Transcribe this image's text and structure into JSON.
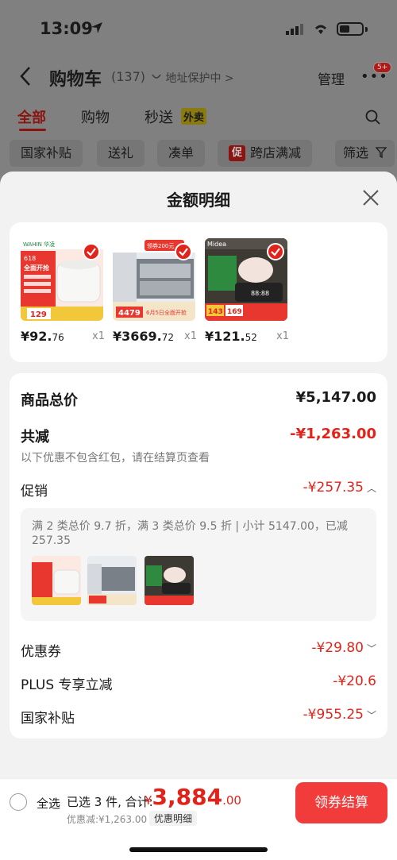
{
  "status": {
    "time": "13:09"
  },
  "nav": {
    "back_label": "<",
    "title": "购物车",
    "count": "(137)",
    "address_protect": "地址保护中 >",
    "manage": "管理",
    "more_badge": "5+"
  },
  "tabs": [
    {
      "label": "全部"
    },
    {
      "label": "购物"
    },
    {
      "label": "秒送"
    }
  ],
  "tab_badge": "外卖",
  "filters": {
    "subsidy": "国家补贴",
    "gift": "送礼",
    "together": "凑单",
    "promo_icon": "促",
    "crossstore": "跨店满减",
    "filter": "筛选"
  },
  "sheet": {
    "title": "金额明细",
    "products": [
      {
        "price_int": "¥92.",
        "price_dec": "76",
        "qty": "x1"
      },
      {
        "price_int": "¥3669.",
        "price_dec": "72",
        "qty": "x1"
      },
      {
        "price_int": "¥121.",
        "price_dec": "52",
        "qty": "x1"
      }
    ],
    "thumb_texts": {
      "p1_brand": "WAHIN 华凌",
      "p1_tag": "618",
      "p1_banner": "全面开抢",
      "p1_price": "129",
      "p2_banner": "领券200元",
      "p2_price": "4479",
      "p2_tag": "6月5日全面开抢",
      "p3_brand": "Midea",
      "p3_price": "143",
      "p3_price2": "169"
    },
    "summary": {
      "total_label": "商品总价",
      "total_value": "¥5,147.00",
      "discount_label": "共减",
      "discount_value": "-¥1,263.00",
      "note": "以下优惠不包含红包，请在结算页查看",
      "promo_label": "促销",
      "promo_value": "-¥257.35",
      "promo_detail": "满 2 类总价 9.7 折，满 3 类总价 9.5 折 | 小计 5147.00，已减 257.35",
      "coupon_label": "优惠券",
      "coupon_value": "-¥29.80",
      "plus_label": "PLUS 专享立减",
      "plus_value": "-¥20.6",
      "subsidy_label": "国家补贴",
      "subsidy_value": "-¥955.25"
    }
  },
  "bottom": {
    "select_all": "全选",
    "selected_total": "已选 3 件, 合计:",
    "total_yen": "¥",
    "total_int": "3,884",
    "total_dec": ".00",
    "discount_line": "优惠减:¥1,263.00",
    "detail_chip": "优惠明细",
    "checkout": "领券结算"
  },
  "colors": {
    "accent": "#e2231a",
    "checkout": "#f23c3c"
  }
}
